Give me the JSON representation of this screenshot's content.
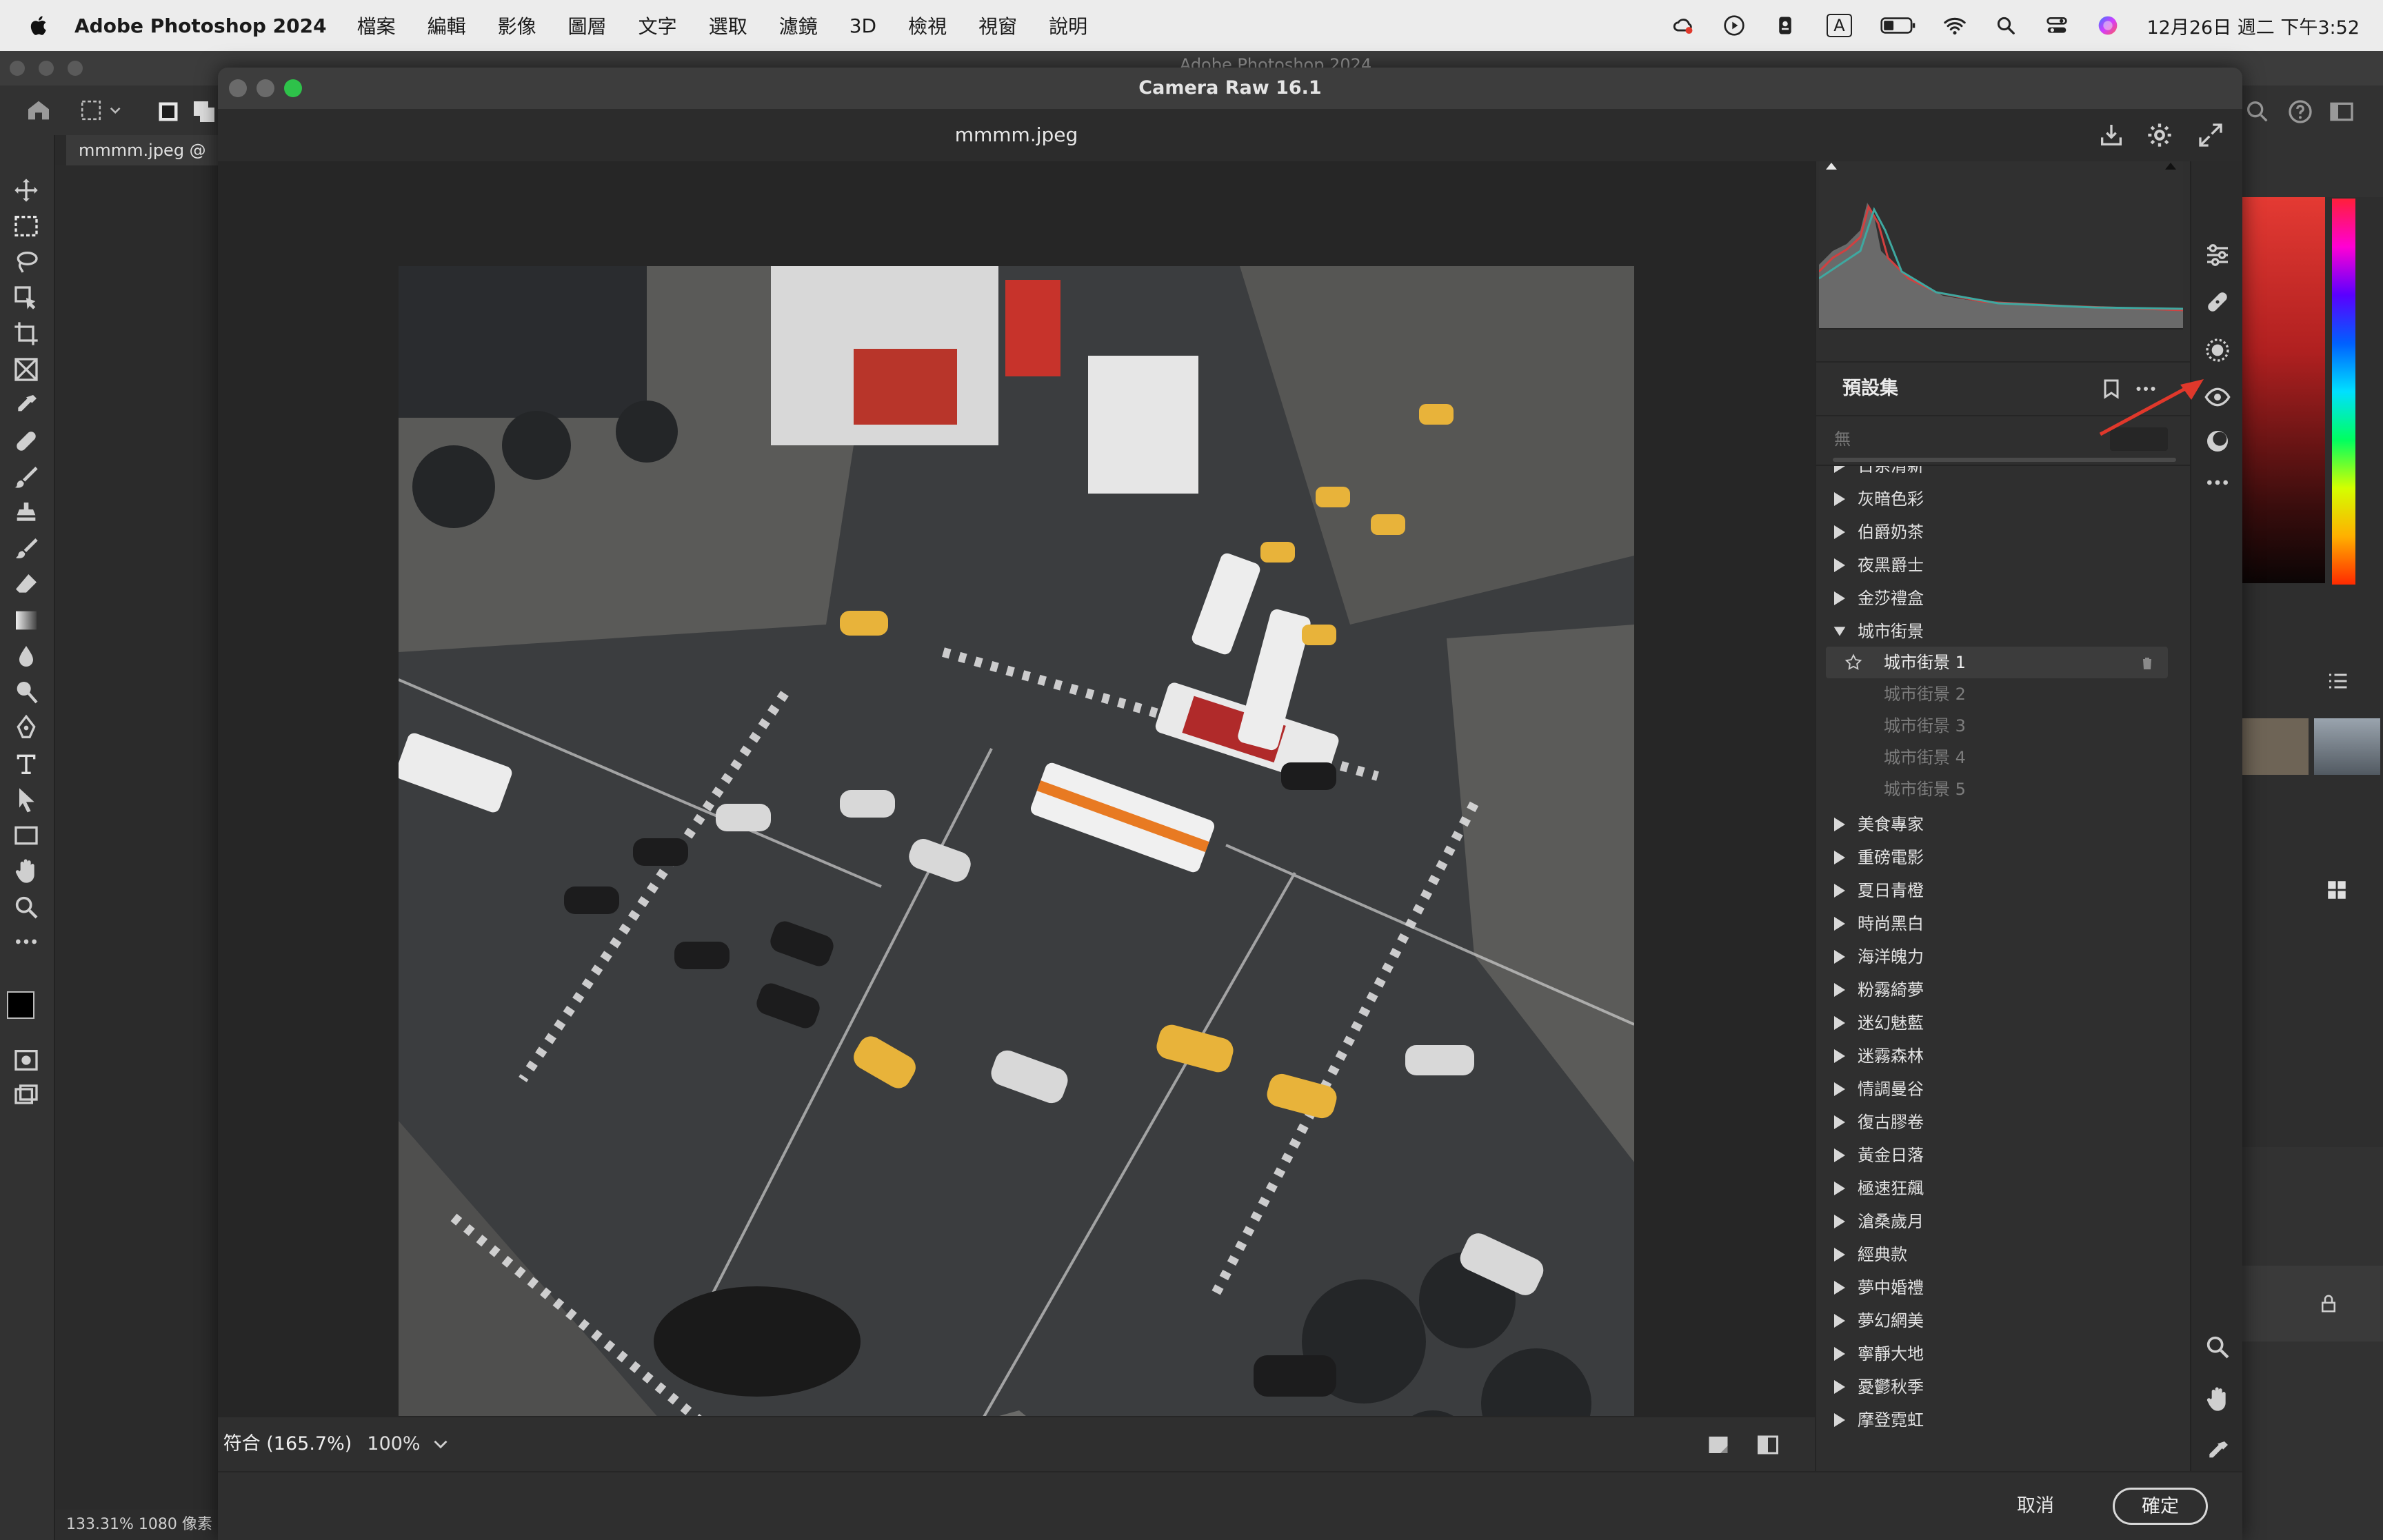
{
  "menubar": {
    "app_name": "Adobe Photoshop 2024",
    "items": [
      "檔案",
      "編輯",
      "影像",
      "圖層",
      "文字",
      "選取",
      "濾鏡",
      "3D",
      "檢視",
      "視窗",
      "說明"
    ],
    "clock": "12月26日 週二 下午3:52",
    "input_indicator": "A"
  },
  "photoshop": {
    "window_title": "Adobe Photoshop 2024",
    "doc_tab": "mmmm.jpeg @",
    "status": "133.31%   1080 像素"
  },
  "camera_raw": {
    "title": "Camera Raw 16.1",
    "filename": "mmmm.jpeg",
    "zoom": {
      "fit_label": "符合 (165.7%)",
      "percent_label": "100%"
    },
    "presets": {
      "title": "預設集",
      "search_placeholder": "無",
      "groups_top": [
        {
          "label": "日系清新"
        },
        {
          "label": "灰暗色彩"
        },
        {
          "label": "伯爵奶茶"
        },
        {
          "label": "夜黑爵士"
        },
        {
          "label": "金莎禮盒"
        }
      ],
      "expanded_group": {
        "label": "城市街景",
        "items": [
          {
            "label": "城市街景 1",
            "selected": true
          },
          {
            "label": "城市街景 2",
            "selected": false
          },
          {
            "label": "城市街景 3",
            "selected": false
          },
          {
            "label": "城市街景 4",
            "selected": false
          },
          {
            "label": "城市街景 5",
            "selected": false
          }
        ]
      },
      "groups_bottom": [
        {
          "label": "美食專家"
        },
        {
          "label": "重磅電影"
        },
        {
          "label": "夏日青橙"
        },
        {
          "label": "時尚黑白"
        },
        {
          "label": "海洋魄力"
        },
        {
          "label": "粉霧綺夢"
        },
        {
          "label": "迷幻魅藍"
        },
        {
          "label": "迷霧森林"
        },
        {
          "label": "情調曼谷"
        },
        {
          "label": "復古膠卷"
        },
        {
          "label": "黃金日落"
        },
        {
          "label": "極速狂飆"
        },
        {
          "label": "滄桑歲月"
        },
        {
          "label": "經典款"
        },
        {
          "label": "夢中婚禮"
        },
        {
          "label": "夢幻網美"
        },
        {
          "label": "寧靜大地"
        },
        {
          "label": "憂鬱秋季"
        },
        {
          "label": "摩登霓虹"
        }
      ]
    },
    "footer": {
      "cancel_label": "取消",
      "ok_label": "確定"
    }
  },
  "colors": {
    "accent_arrow": "#e0382b",
    "panel_bg": "#2f2f2f",
    "selected_row": "#3c3c3c"
  }
}
